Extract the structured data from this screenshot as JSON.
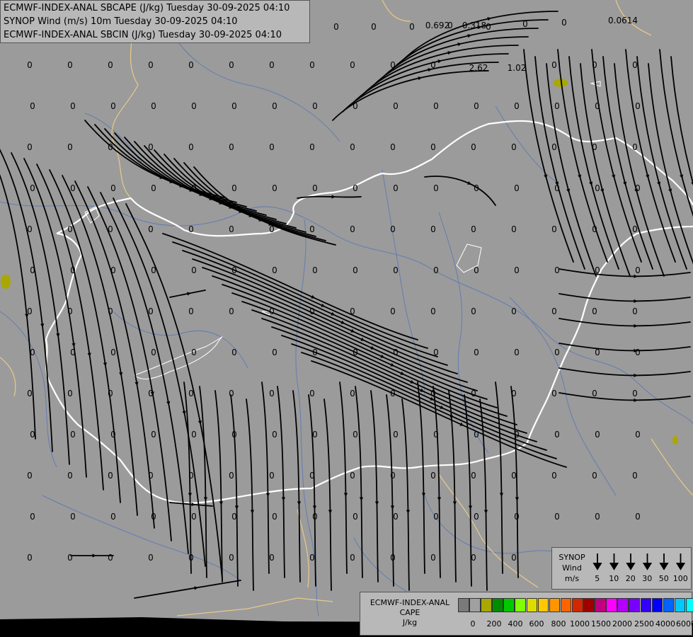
{
  "header": {
    "line1": "ECMWF-INDEX-ANAL SBCAPE (J/kg) Tuesday 30-09-2025 04:10",
    "line2": "SYNOP Wind (m/s) 10m Tuesday 30-09-2025 04:10",
    "line3": "ECMWF-INDEX-ANAL SBCIN (J/kg) Tuesday 30-09-2025 04:10"
  },
  "colors": {
    "background": "#9b9b9b",
    "country_border": "#ffffff",
    "state_border": "#e9c98a",
    "river": "#5a78b4",
    "streamline": "#000000"
  },
  "wind_legend": {
    "title_lines": [
      "SYNOP",
      "Wind",
      "m/s"
    ],
    "speeds": [
      "5",
      "10",
      "20",
      "30",
      "50",
      "100"
    ]
  },
  "cape_legend": {
    "title_lines": [
      "ECMWF-INDEX-ANAL",
      "CAPE",
      "J/kg"
    ],
    "colors": [
      "#7a7a7a",
      "#a0a0a0",
      "#a8a800",
      "#008c00",
      "#00c800",
      "#80ff00",
      "#dcdc00",
      "#ffc800",
      "#ff9600",
      "#ff6400",
      "#d22800",
      "#a00000",
      "#c00080",
      "#ff00ff",
      "#b400ff",
      "#7800ff",
      "#3200ff",
      "#0000ff",
      "#0064ff",
      "#00c8ff",
      "#00ffff",
      "#ffffff"
    ],
    "ticks": [
      "0",
      "200",
      "400",
      "600",
      "800",
      "1000",
      "1500",
      "2000",
      "2500",
      "4000",
      "6000"
    ]
  },
  "cape_values": [
    "0",
    "0",
    "0",
    "0",
    "0",
    "0.692",
    "0.318",
    "0",
    "0",
    "0.0614",
    "0",
    "0",
    "0",
    "0",
    "0",
    "0",
    "0",
    "0",
    "0",
    "0",
    "0",
    "2.62",
    "1.02",
    "0",
    "0",
    "0",
    "0",
    "0",
    "0",
    "0",
    "0",
    "0",
    "0",
    "0",
    "0",
    "0",
    "0",
    "0",
    "0",
    "0",
    "0",
    "0",
    "0",
    "0",
    "0",
    "0",
    "0",
    "0",
    "0",
    "0",
    "0",
    "0",
    "0",
    "0",
    "0",
    "0",
    "0",
    "0",
    "0",
    "0",
    "0",
    "0",
    "0",
    "0",
    "0",
    "0",
    "0",
    "0",
    "0",
    "0",
    "0",
    "0",
    "0",
    "0",
    "0",
    "0",
    "0",
    "0",
    "0",
    "0",
    "0",
    "0",
    "0",
    "0",
    "0",
    "0",
    "0",
    "0",
    "0",
    "0",
    "0",
    "0",
    "0",
    "0",
    "0",
    "0",
    "0",
    "0",
    "0",
    "0",
    "0",
    "0",
    "0",
    "0",
    "0",
    "0",
    "0",
    "0",
    "0",
    "0",
    "0",
    "0",
    "0",
    "0",
    "0",
    "0",
    "0",
    "0",
    "0",
    "0",
    "0",
    "0",
    "0",
    "0",
    "0",
    "0",
    "0",
    "0",
    "0",
    "0",
    "0",
    "0",
    "0",
    "0",
    "0",
    "0",
    "0",
    "0",
    "0",
    "0",
    "0",
    "0",
    "0",
    "0",
    "0",
    "0",
    "0",
    "0",
    "0",
    "0",
    "0",
    "0",
    "0",
    "0",
    "0",
    "0",
    "0",
    "0",
    "0",
    "0",
    "0",
    "0",
    "0",
    "0",
    "0",
    "0",
    "0",
    "0",
    "0",
    "0",
    "0",
    "0",
    "0",
    "0",
    "0",
    "0",
    "0",
    "0",
    "0",
    "0",
    "0",
    "0",
    "0",
    "0",
    "0",
    "0",
    "0",
    "0",
    "0",
    "0",
    "0",
    "0",
    "0",
    "0",
    "0",
    "0",
    "0",
    "0",
    "0",
    "0",
    "0",
    "0",
    "0",
    "0",
    "0",
    "0",
    "0",
    "0",
    "0",
    "0",
    "0",
    "0",
    "0",
    "0",
    "0",
    "0",
    "0"
  ]
}
